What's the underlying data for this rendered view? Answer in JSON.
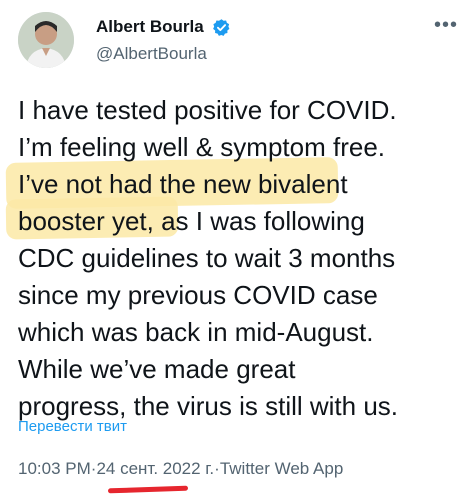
{
  "author": {
    "display_name": "Albert Bourla",
    "handle": "@AlbertBourla",
    "verified_icon": "verified-badge-icon",
    "avatar_icon": "profile-photo"
  },
  "more_icon": "more-options-icon",
  "tweet": {
    "lines": [
      "I have tested positive for COVID.",
      "I’m feeling well & symptom free.",
      "I’ve not had the new bivalent",
      "booster yet, as I was following",
      "CDC guidelines to wait 3 months",
      "since my previous COVID case",
      "which was back in mid-August.",
      "While we’ve made great",
      "progress, the virus is still with us."
    ]
  },
  "translate_label": "Перевести твит",
  "meta": {
    "time": "10:03 PM",
    "sep1": " · ",
    "date": "24 сент. 2022 г.",
    "sep2": " · ",
    "source": "Twitter Web App"
  },
  "colors": {
    "accent": "#1d9bf0",
    "muted": "#536471",
    "highlight": "#fbe9a6",
    "underline": "#e6262e"
  }
}
